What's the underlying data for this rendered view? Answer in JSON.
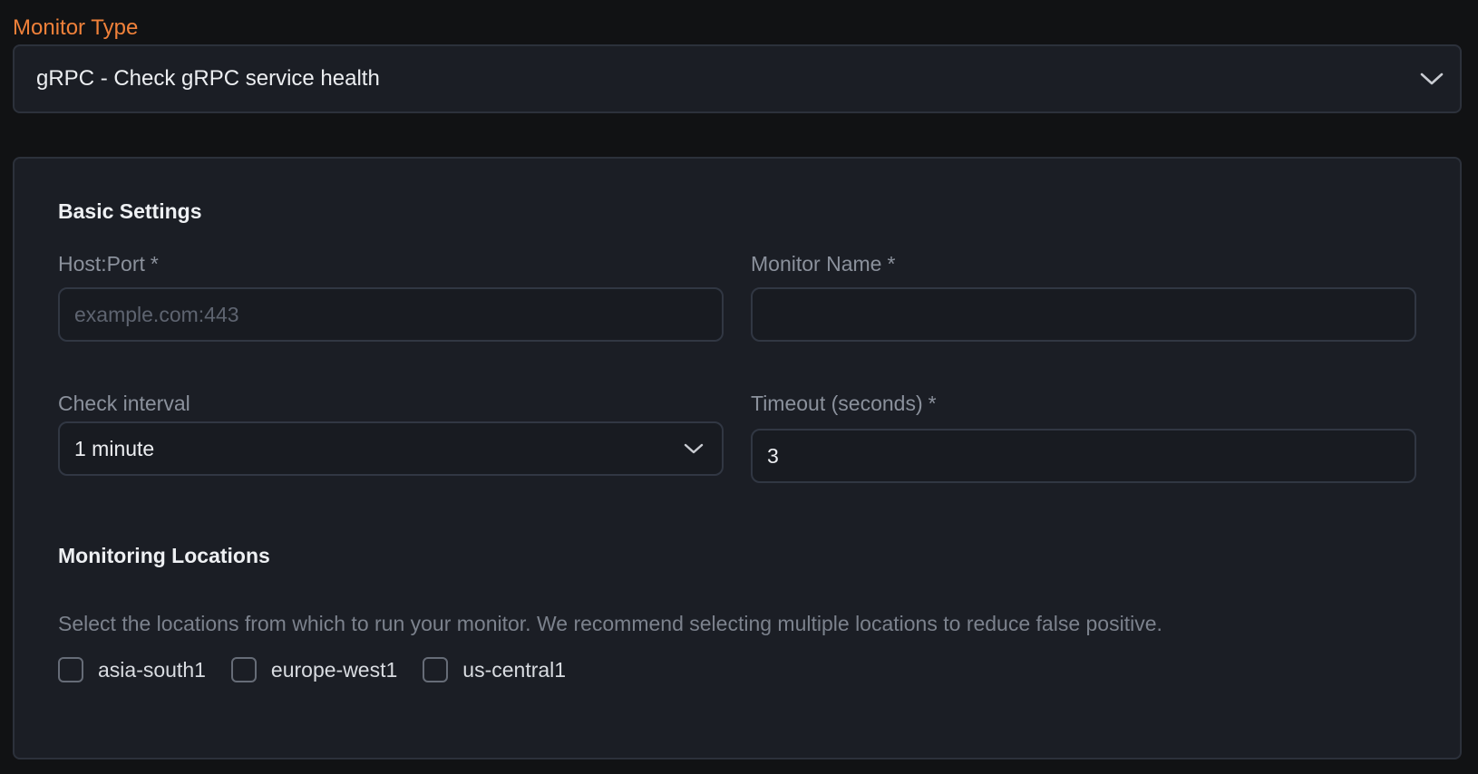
{
  "monitor_type": {
    "label": "Monitor Type",
    "selected": "gRPC - Check gRPC service health",
    "icon": "chevron-down-icon"
  },
  "basic_settings": {
    "title": "Basic Settings",
    "host_port": {
      "label": "Host:Port",
      "required_mark": "*",
      "placeholder": "example.com:443",
      "value": ""
    },
    "monitor_name": {
      "label": "Monitor Name",
      "required_mark": "*",
      "placeholder": "",
      "value": ""
    },
    "check_interval": {
      "label": "Check interval",
      "selected": "1 minute",
      "icon": "chevron-down-icon"
    },
    "timeout": {
      "label": "Timeout (seconds)",
      "required_mark": "*",
      "value": "3"
    }
  },
  "monitoring_locations": {
    "title": "Monitoring Locations",
    "help": "Select the locations from which to run your monitor. We recommend selecting multiple locations to reduce false positive.",
    "items": [
      {
        "label": "asia-south1",
        "checked": false
      },
      {
        "label": "europe-west1",
        "checked": false
      },
      {
        "label": "us-central1",
        "checked": false
      }
    ]
  },
  "colors": {
    "accent": "#f0813a",
    "background": "#111214",
    "panel": "#1b1e25",
    "border": "#2c313b"
  }
}
